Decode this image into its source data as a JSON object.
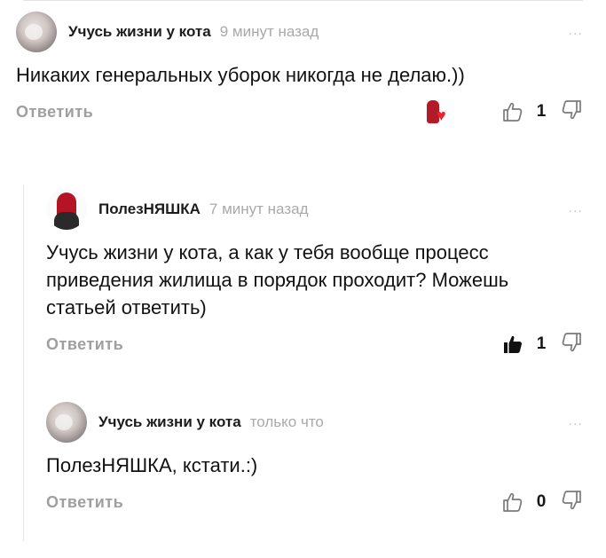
{
  "comments": [
    {
      "author": "Учусь жизни у кота",
      "time": "9 минут назад",
      "text": "Никаких генеральных уборок никогда не делаю.))",
      "reply_label": "Ответить",
      "likes": "1",
      "liked": false,
      "more": "..."
    },
    {
      "author": "ПолезНЯШКА",
      "time": "7 минут назад",
      "text": "Учусь жизни у кота, а как у тебя вообще процесс приведения жилища в порядок проходит? Можешь статьей ответить)",
      "reply_label": "Ответить",
      "likes": "1",
      "liked": true,
      "more": "..."
    },
    {
      "author": "Учусь жизни у кота",
      "time": "только что",
      "text": "ПолезНЯШКА, кстати.:)",
      "reply_label": "Ответить",
      "likes": "0",
      "liked": false,
      "more": "..."
    }
  ],
  "colors": {
    "accent_red": "#e8222f",
    "muted": "#a9a9a9"
  }
}
